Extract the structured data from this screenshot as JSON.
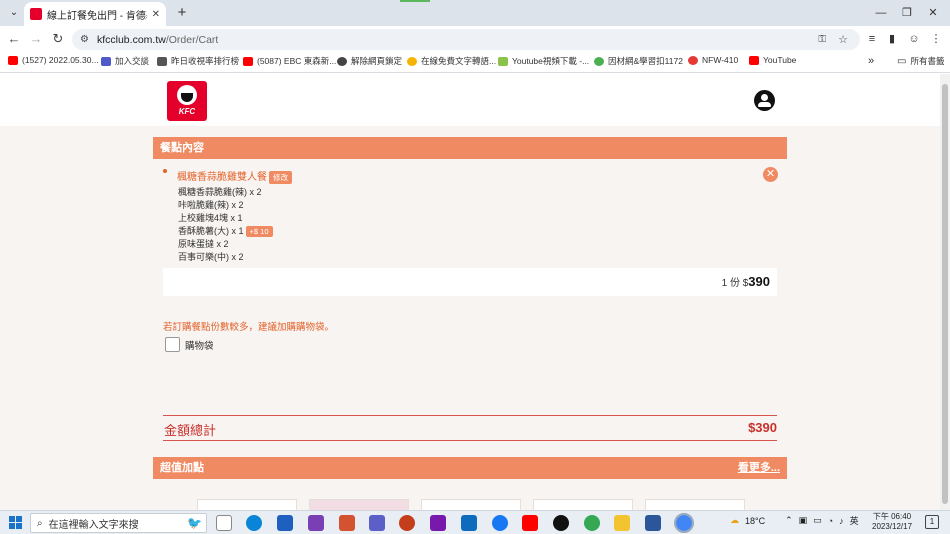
{
  "browser": {
    "tab_title": "線上訂餐免出門 - 肯德基www...",
    "url_host": "kfcclub.com.tw",
    "url_path": "/Order/Cart",
    "new_tab": "+",
    "bookmarks": [
      {
        "label": "(1527) 2022.05.30...",
        "icon": "youtube-icon",
        "color": "#ff0000"
      },
      {
        "label": "加入交談",
        "icon": "teams-icon",
        "color": "#5059c9"
      },
      {
        "label": "昨日收視率排行榜",
        "icon": "monitor-icon",
        "color": "#555555"
      },
      {
        "label": "(5087) EBC 東森新...",
        "icon": "youtube-icon",
        "color": "#ff0000"
      },
      {
        "label": "解除網頁鎖定",
        "icon": "globe-icon",
        "color": "#444444"
      },
      {
        "label": "在線免費文字轉語...",
        "icon": "smile-icon",
        "color": "#f4b400"
      },
      {
        "label": "Youtube視頻下載 -...",
        "icon": "leaf-icon",
        "color": "#8bc34a"
      },
      {
        "label": "因材網&學習扣1172",
        "icon": "eye-icon",
        "color": "#4caf50"
      },
      {
        "label": "NFW-410",
        "icon": "red-circle-icon",
        "color": "#e53935"
      },
      {
        "label": "YouTube",
        "icon": "youtube-icon",
        "color": "#ff0000"
      }
    ],
    "bookmarks_more": "»",
    "all_bookmarks": "所有書籤"
  },
  "site": {
    "logo_text": "KFC",
    "order_section_title": "餐點內容",
    "item": {
      "name": "楓糖香蒜脆雞雙人餐",
      "edit_tag": "修改",
      "sub_items": [
        {
          "text": "楓糖香蒜脆雞(辣) x 2",
          "tag": ""
        },
        {
          "text": "咔啦脆雞(辣) x 2",
          "tag": ""
        },
        {
          "text": "上校雞塊4塊 x 1",
          "tag": ""
        },
        {
          "text": "香酥脆薯(大) x 1",
          "tag": "+$ 10"
        },
        {
          "text": "原味蛋撻 x 2",
          "tag": ""
        },
        {
          "text": "百事可樂(中) x 2",
          "tag": ""
        }
      ],
      "qty_text": "1 份 $",
      "price": "390"
    },
    "bag_note": "若訂購餐點份數較多，建議加購購物袋。",
    "bag_label": "購物袋",
    "total_label": "金額總計",
    "total_value": "$390",
    "addon_title": "超值加點",
    "see_more": "看更多..."
  },
  "taskbar": {
    "search_placeholder": "在這裡輸入文字來搜",
    "weather": "18°C",
    "ime": "英",
    "time": "下午 06:40",
    "date": "2023/12/17",
    "notifications": "1"
  },
  "colors": {
    "brand_red": "#e4002b",
    "section_orange": "#f08a62",
    "accent_text": "#e4632c",
    "total_red": "#c9302c"
  }
}
